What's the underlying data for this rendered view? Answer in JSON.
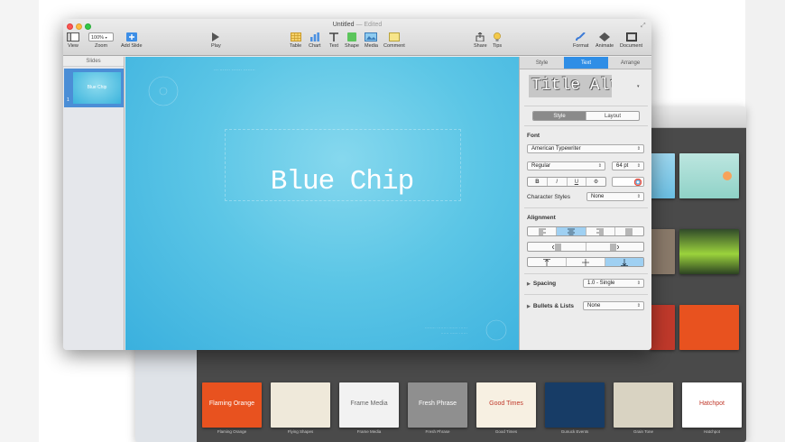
{
  "window": {
    "title": "Untitled",
    "edited": "— Edited"
  },
  "toolbar": {
    "view": "View",
    "zoom_value": "100%",
    "zoom": "Zoom",
    "add_slide": "Add Slide",
    "play": "Play",
    "table": "Table",
    "chart": "Chart",
    "text": "Text",
    "shape": "Shape",
    "media": "Media",
    "comment": "Comment",
    "share": "Share",
    "tips": "Tips",
    "format": "Format",
    "animate": "Animate",
    "document": "Document"
  },
  "slides_panel": {
    "header": "Slides",
    "slide_number": "1",
    "thumb_title": "Blue Chip"
  },
  "slide": {
    "title": "Blue Chip"
  },
  "inspector": {
    "tabs": [
      "Style",
      "Text",
      "Arrange"
    ],
    "active_tab": "Text",
    "paragraph_style": "Title Alt",
    "subtabs": [
      "Style",
      "Layout"
    ],
    "font_label": "Font",
    "font_family": "American Typewriter",
    "font_weight": "Regular",
    "font_size": "64 pt",
    "format_buttons": [
      "B",
      "I",
      "U",
      "⚙"
    ],
    "character_styles_label": "Character Styles",
    "character_styles_value": "None",
    "alignment_label": "Alignment",
    "spacing_label": "Spacing",
    "spacing_value": "1.0 - Single",
    "bullets_label": "Bullets & Lists",
    "bullets_value": "None"
  },
  "themes": [
    {
      "name": "Flaming Orange",
      "preview": "Flaming Orange",
      "color": "#e8521f",
      "text_color": "#ffffff"
    },
    {
      "name": "Flying Shapes",
      "preview": "",
      "color": "#efe9da",
      "text_color": "#555555"
    },
    {
      "name": "Frame Media",
      "preview": "Frame Media",
      "color": "#f2f2f2",
      "text_color": "#666666"
    },
    {
      "name": "Fresh Phrase",
      "preview": "Fresh Phrase",
      "color": "#8f8f8f",
      "text_color": "#ffffff"
    },
    {
      "name": "Good Times",
      "preview": "Good Times",
      "color": "#f7f0e2",
      "text_color": "#c0392b"
    },
    {
      "name": "Gunuck Events",
      "preview": "",
      "color": "#173c66",
      "text_color": "#ffffff"
    },
    {
      "name": "Grain Tone",
      "preview": "",
      "color": "#d9d3c2",
      "text_color": "#666666"
    },
    {
      "name": "Hatchpot",
      "preview": "Hatchpot",
      "color": "#ffffff",
      "text_color": "#c0392b"
    }
  ]
}
